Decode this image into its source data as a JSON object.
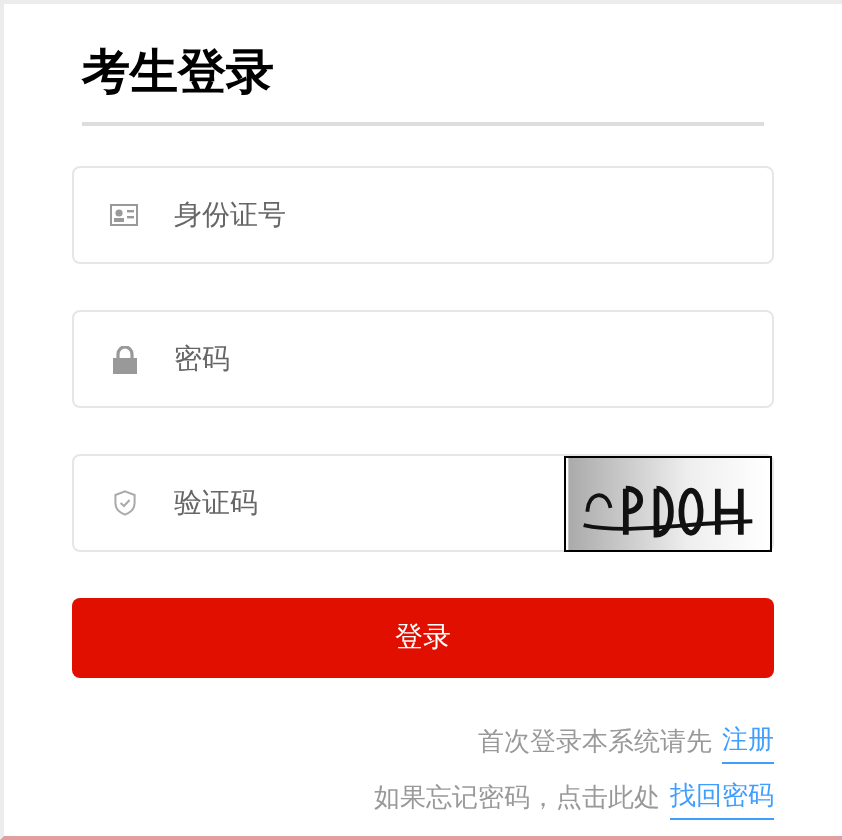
{
  "title": "考生登录",
  "fields": [
    {
      "kind": "id",
      "placeholder": "身份证号"
    },
    {
      "kind": "password",
      "placeholder": "密码"
    },
    {
      "kind": "captcha",
      "placeholder": "验证码"
    }
  ],
  "login_button": "登录",
  "links": [
    {
      "text": "首次登录本系统请先",
      "link": "注册"
    },
    {
      "text": "如果忘记密码，点击此处",
      "link": "找回密码"
    }
  ]
}
